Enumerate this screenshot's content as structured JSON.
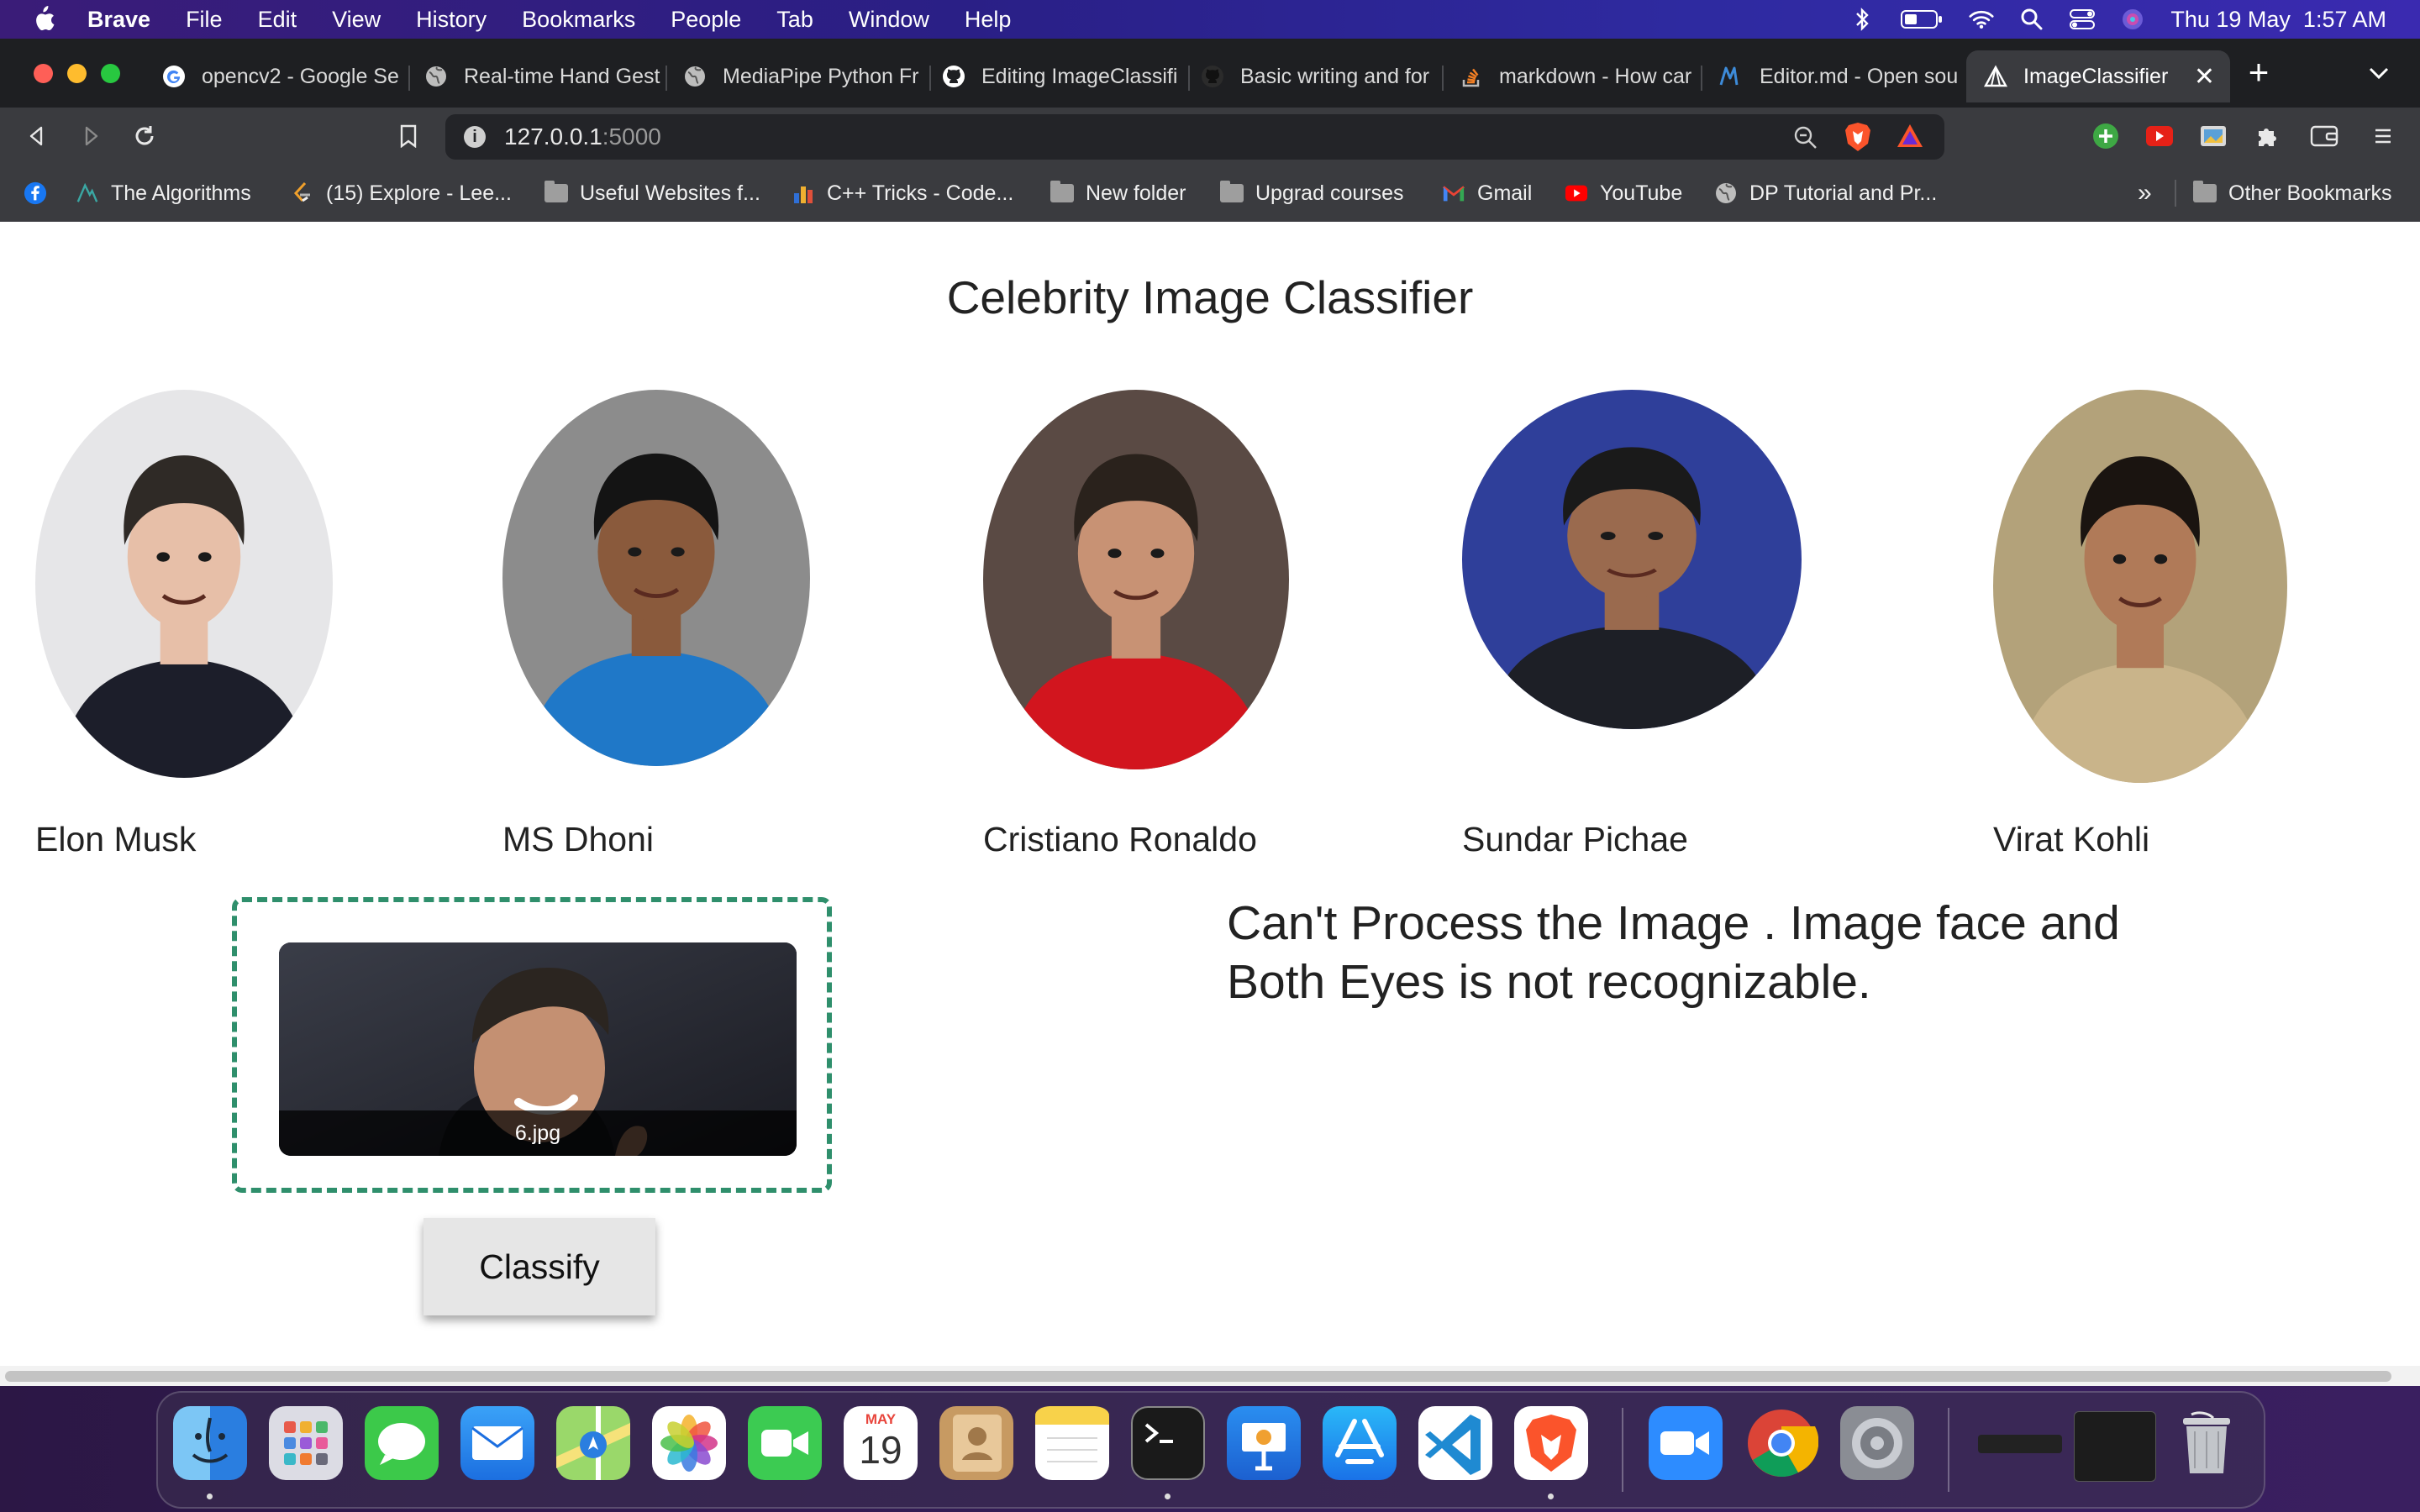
{
  "menubar": {
    "app_name": "Brave",
    "items": [
      "File",
      "Edit",
      "View",
      "History",
      "Bookmarks",
      "People",
      "Tab",
      "Window",
      "Help"
    ],
    "clock": "Thu 19 May  1:57 AM"
  },
  "tabs": [
    {
      "title": "opencv2 - Google Se",
      "icon": "google-icon"
    },
    {
      "title": "Real-time Hand Gest",
      "icon": "globe-icon"
    },
    {
      "title": "MediaPipe Python Fr",
      "icon": "globe-icon"
    },
    {
      "title": "Editing ImageClassifi",
      "icon": "github-icon"
    },
    {
      "title": "Basic writing and for",
      "icon": "github-icon"
    },
    {
      "title": "markdown - How car",
      "icon": "stackoverflow-icon"
    },
    {
      "title": "Editor.md - Open sou",
      "icon": "editormd-icon"
    },
    {
      "title": "ImageClassifier",
      "icon": "app-icon",
      "active": true
    }
  ],
  "address": {
    "host": "127.0.0.1",
    "port": ":5000"
  },
  "bookmarks": [
    {
      "label": "",
      "icon": "facebook-icon"
    },
    {
      "label": "The Algorithms",
      "icon": "algorithms-icon"
    },
    {
      "label": "(15) Explore - Lee...",
      "icon": "leetcode-icon"
    },
    {
      "label": "Useful Websites f...",
      "icon": "folder-icon"
    },
    {
      "label": "C++ Tricks - Code...",
      "icon": "chart-icon"
    },
    {
      "label": "New folder",
      "icon": "folder-icon"
    },
    {
      "label": "Upgrad courses",
      "icon": "folder-icon"
    },
    {
      "label": "Gmail",
      "icon": "gmail-icon"
    },
    {
      "label": "YouTube",
      "icon": "youtube-icon"
    },
    {
      "label": "DP Tutorial and Pr...",
      "icon": "globe-icon"
    }
  ],
  "bookmarks_more": "»",
  "other_bookmarks": "Other Bookmarks",
  "page": {
    "title": "Celebrity Image Classifier",
    "celebrities": [
      {
        "name": "Elon Musk",
        "bg": "#e6e6e8",
        "skin": "#e7bfa8",
        "hair": "#2f2a26",
        "top": "#1c1e2a"
      },
      {
        "name": "MS Dhoni",
        "bg": "#8c8c8c",
        "skin": "#8a5a3c",
        "hair": "#141414",
        "top": "#1f78c8"
      },
      {
        "name": "Cristiano Ronaldo",
        "bg": "#5a4a44",
        "skin": "#c89274",
        "hair": "#2a221c",
        "top": "#d2151e"
      },
      {
        "name": "Sundar Pichae",
        "bg": "#2f3f9a",
        "skin": "#9a6a4e",
        "hair": "#1a1a1a",
        "top": "#1d1f26"
      },
      {
        "name": "Virat Kohli",
        "bg": "#b3a27a",
        "skin": "#b07a58",
        "hair": "#1a1410",
        "top": "#c9b48a"
      }
    ],
    "uploaded_file": "6.jpg",
    "classify_label": "Classify",
    "error_message": "Can't Process the Image . Image face and Both Eyes is not recognizable."
  },
  "dock": {
    "apps": [
      "Finder",
      "Launchpad",
      "Messages",
      "Mail",
      "Maps",
      "Photos",
      "FaceTime",
      "Calendar",
      "Contacts",
      "Notes",
      "Terminal",
      "Keynote",
      "App Store",
      "Visual Studio Code",
      "Brave Browser",
      "Zoom",
      "Google Chrome",
      "System Preferences"
    ],
    "calendar_month": "MAY",
    "calendar_day": "19"
  }
}
